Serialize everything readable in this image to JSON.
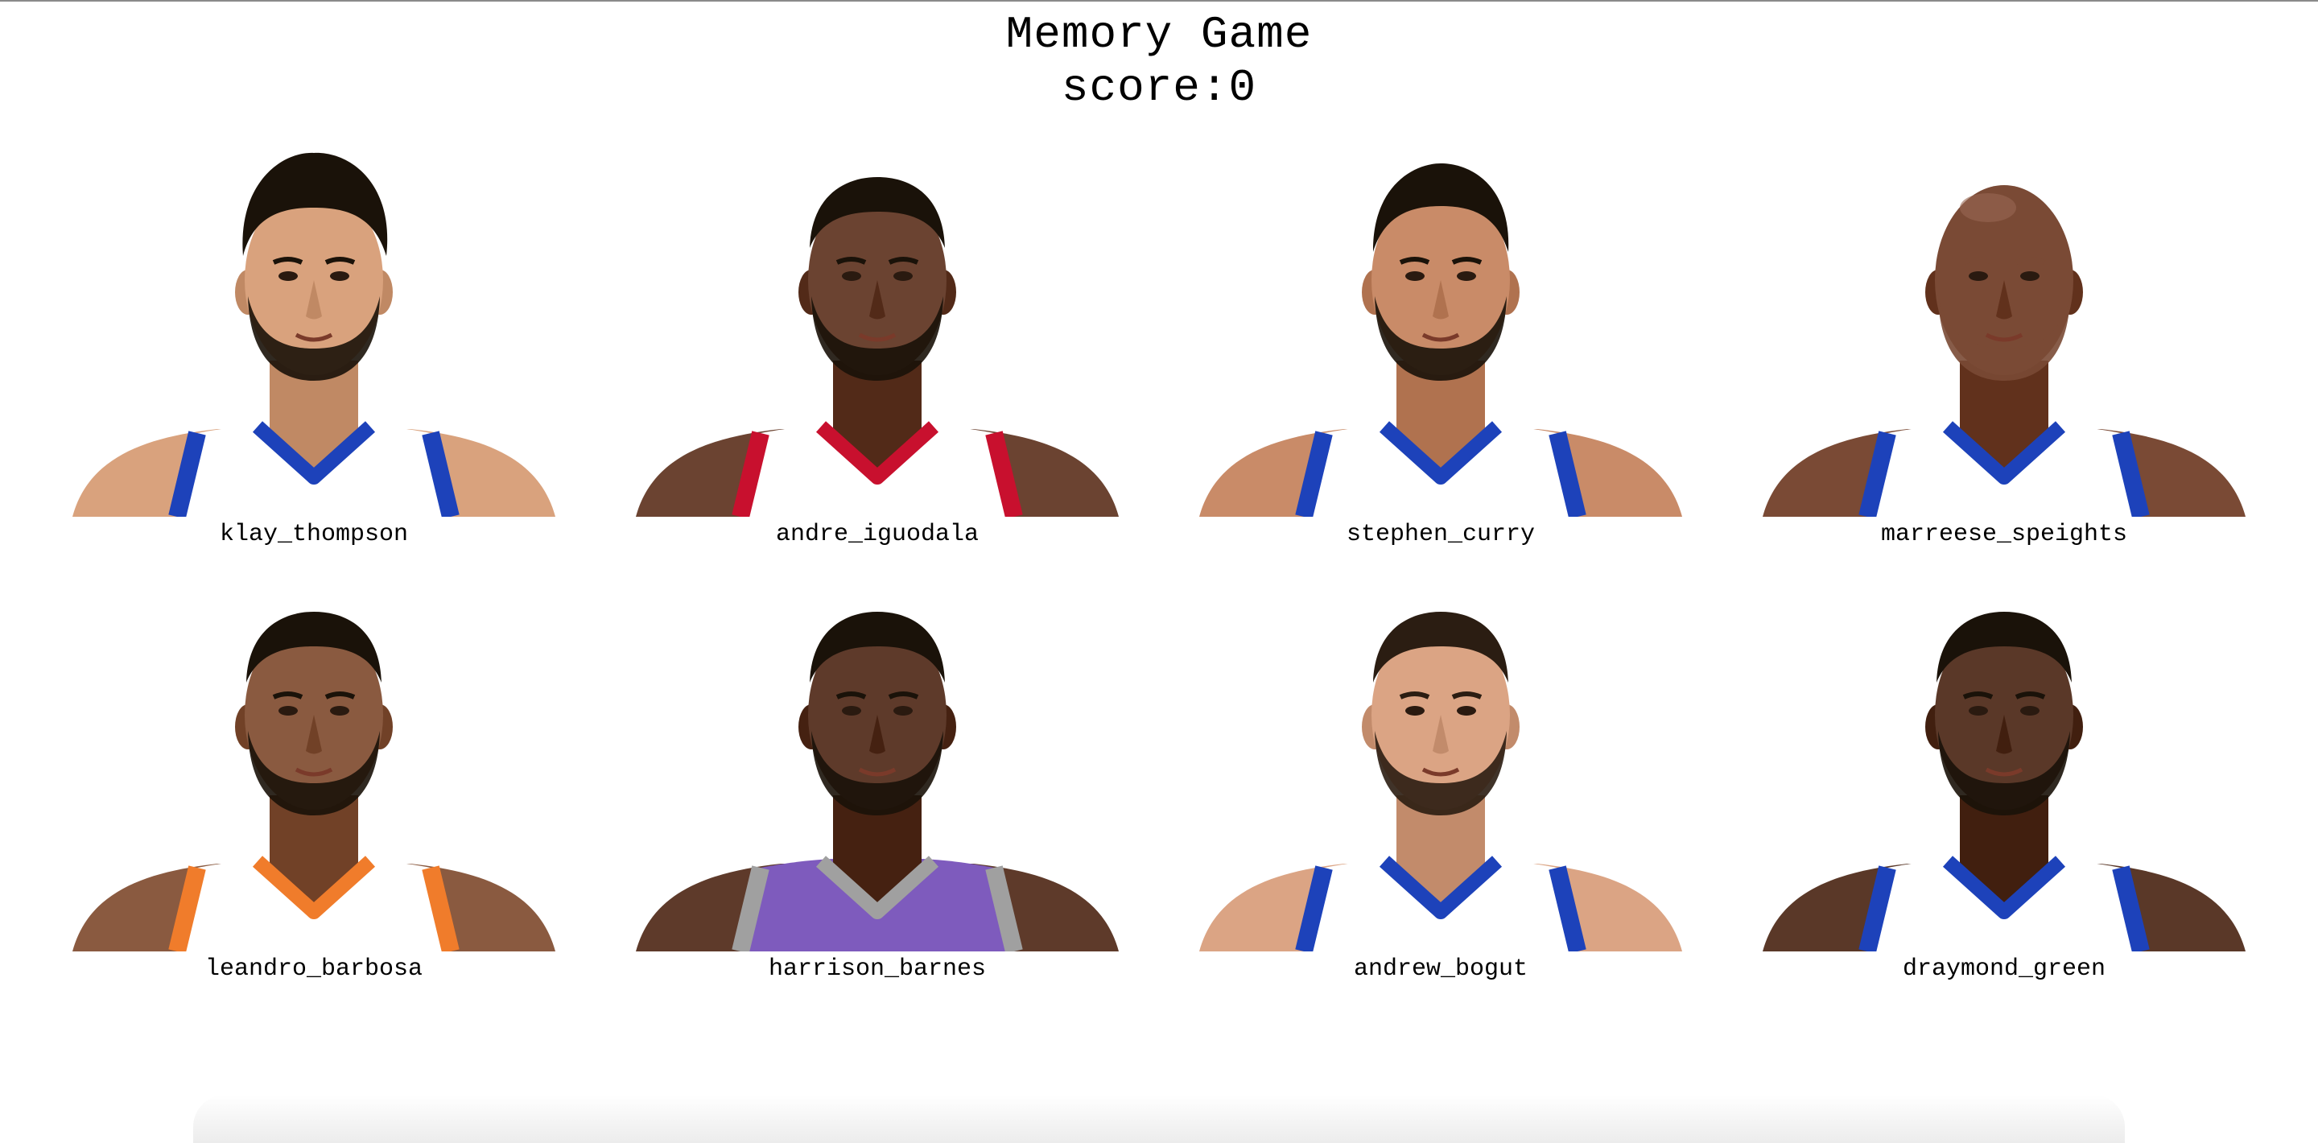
{
  "header": {
    "title": "Memory Game",
    "score_text": "score:0"
  },
  "cards": [
    {
      "name": "klay_thompson",
      "skin": "#d9a27d",
      "hair": "#1a1209",
      "jersey": "#ffffff",
      "trim": "#1d42ba",
      "beard": true,
      "hair_style": "curly"
    },
    {
      "name": "andre_iguodala",
      "skin": "#6b4331",
      "hair": "#1a1209",
      "jersey": "#ffffff",
      "trim": "#c8102e",
      "beard": true,
      "hair_style": "short"
    },
    {
      "name": "stephen_curry",
      "skin": "#c98b68",
      "hair": "#1a1209",
      "jersey": "#ffffff",
      "trim": "#1d42ba",
      "beard": true,
      "hair_style": "braids"
    },
    {
      "name": "marreese_speights",
      "skin": "#7a4a35",
      "hair": "#7a4a35",
      "jersey": "#ffffff",
      "trim": "#1d42ba",
      "beard": true,
      "hair_style": "bald"
    },
    {
      "name": "leandro_barbosa",
      "skin": "#8a5a40",
      "hair": "#1a1209",
      "jersey": "#ffffff",
      "trim": "#f07c2b",
      "beard": true,
      "hair_style": "short"
    },
    {
      "name": "harrison_barnes",
      "skin": "#5e3a2a",
      "hair": "#1a1209",
      "jersey": "#7e5bbd",
      "trim": "#a0a0a0",
      "beard": true,
      "hair_style": "short"
    },
    {
      "name": "andrew_bogut",
      "skin": "#dba484",
      "hair": "#2b1d12",
      "jersey": "#ffffff",
      "trim": "#1d42ba",
      "beard": true,
      "hair_style": "short"
    },
    {
      "name": "draymond_green",
      "skin": "#5a3828",
      "hair": "#1a1209",
      "jersey": "#ffffff",
      "trim": "#1d42ba",
      "beard": true,
      "hair_style": "short"
    }
  ]
}
